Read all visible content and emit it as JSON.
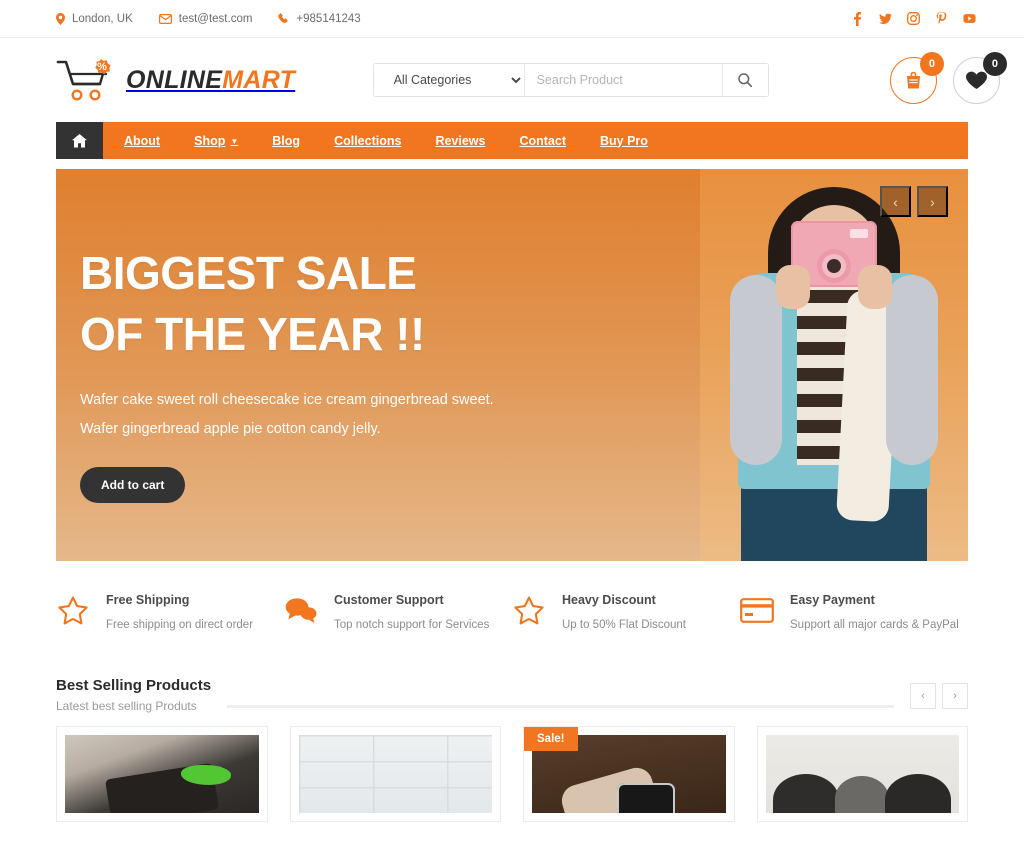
{
  "topbar": {
    "location": "London, UK",
    "email": "test@test.com",
    "phone": "+985141243",
    "social": [
      {
        "name": "facebook-icon",
        "label": "Facebook"
      },
      {
        "name": "twitter-icon",
        "label": "Twitter"
      },
      {
        "name": "instagram-icon",
        "label": "Instagram"
      },
      {
        "name": "pinterest-icon",
        "label": "Pinterest"
      },
      {
        "name": "youtube-icon",
        "label": "YouTube"
      }
    ],
    "accent_color": "#f1761f"
  },
  "header": {
    "logo": {
      "primary": "ONLINE",
      "secondary": "MART",
      "badge": "%"
    },
    "search": {
      "category_selected": "All Categories",
      "category_options": [
        "All Categories"
      ],
      "placeholder": "Search Product",
      "value": ""
    },
    "cart": {
      "count": "0"
    },
    "wishlist": {
      "count": "0"
    }
  },
  "nav": {
    "home_label": "Home",
    "items": [
      {
        "label": "About",
        "has_dropdown": false
      },
      {
        "label": "Shop",
        "has_dropdown": true
      },
      {
        "label": "Blog",
        "has_dropdown": false
      },
      {
        "label": "Collections",
        "has_dropdown": false
      },
      {
        "label": "Reviews",
        "has_dropdown": false
      },
      {
        "label": "Contact",
        "has_dropdown": false
      },
      {
        "label": "Buy Pro",
        "has_dropdown": false
      }
    ],
    "bg_color": "#f1761f",
    "home_bg_color": "#333333"
  },
  "hero": {
    "title_line1": "BIGGEST SALE",
    "title_line2": "OF THE YEAR !!",
    "sub_line1": "Wafer cake sweet roll cheesecake ice cream gingerbread sweet.",
    "sub_line2": "Wafer gingerbread apple pie cotton candy jelly.",
    "cta_label": "Add to cart",
    "prev_label": "‹",
    "next_label": "›"
  },
  "features": [
    {
      "icon": "star-icon",
      "title": "Free Shipping",
      "desc": "Free shipping on direct order"
    },
    {
      "icon": "chat-bubbles-icon",
      "title": "Customer Support",
      "desc": "Top notch support for Services"
    },
    {
      "icon": "star-icon",
      "title": "Heavy Discount",
      "desc": "Up to 50% Flat Discount"
    },
    {
      "icon": "credit-card-icon",
      "title": "Easy Payment",
      "desc": "Support all major cards & PayPal"
    }
  ],
  "best_selling": {
    "title": "Best Selling Products",
    "subtitle": "Latest best selling Produts",
    "prev_label": "‹",
    "next_label": "›",
    "products": [
      {
        "image": "card-payment-terminal",
        "badge": ""
      },
      {
        "image": "white-brick-wall",
        "badge": ""
      },
      {
        "image": "smart-watch-on-wrist",
        "badge": "Sale!"
      },
      {
        "image": "camera-lenses",
        "badge": ""
      }
    ]
  }
}
